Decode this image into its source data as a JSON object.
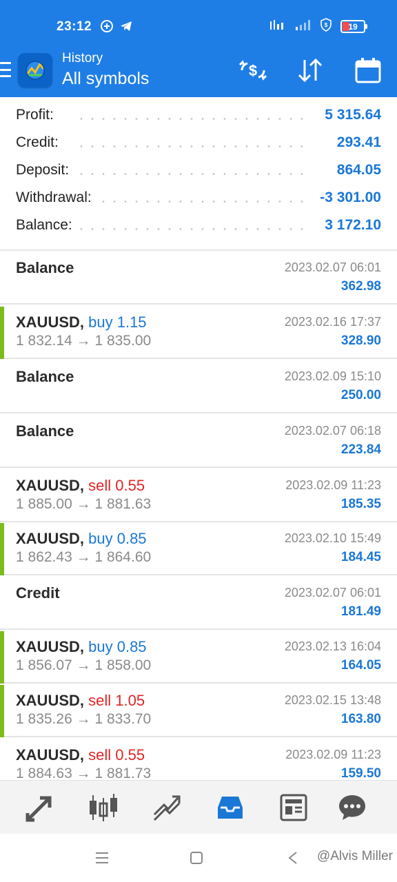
{
  "status_bar": {
    "time": "23:12",
    "battery": "19",
    "icons": [
      "plus-circle-icon",
      "telegram-icon",
      "network-speed-icon",
      "signal-icon",
      "vpn-shield-icon",
      "battery-icon"
    ]
  },
  "app_bar": {
    "subtitle": "History",
    "title": "All symbols",
    "icons": [
      "menu-icon",
      "app-logo-icon",
      "currency-exchange-icon",
      "sort-icon",
      "calendar-icon"
    ]
  },
  "summary": {
    "rows": [
      {
        "label": "Profit:",
        "value": "5 315.64"
      },
      {
        "label": "Credit:",
        "value": "293.41"
      },
      {
        "label": "Deposit:",
        "value": "864.05"
      },
      {
        "label": "Withdrawal:",
        "value": "-3 301.00"
      },
      {
        "label": "Balance:",
        "value": "3 172.10"
      }
    ]
  },
  "history": {
    "items": [
      {
        "kind": "op",
        "title": "Balance",
        "date": "2023.02.07 06:01",
        "amount": "362.98"
      },
      {
        "kind": "deal",
        "symbol": "XAUUSD,",
        "side": "buy",
        "volume": "buy 1.15",
        "open": "1 832.14",
        "close": "1 835.00",
        "arrow": "→",
        "date": "2023.02.16 17:37",
        "amount": "328.90"
      },
      {
        "kind": "op",
        "title": "Balance",
        "date": "2023.02.09 15:10",
        "amount": "250.00"
      },
      {
        "kind": "op",
        "title": "Balance",
        "date": "2023.02.07 06:18",
        "amount": "223.84"
      },
      {
        "kind": "deal",
        "symbol": "XAUUSD,",
        "side": "sell",
        "volume": "sell 0.55",
        "open": "1 885.00",
        "close": "1 881.63",
        "arrow": "→",
        "date": "2023.02.09 11:23",
        "amount": "185.35"
      },
      {
        "kind": "deal",
        "symbol": "XAUUSD,",
        "side": "buy",
        "volume": "buy 0.85",
        "open": "1 862.43",
        "close": "1 864.60",
        "arrow": "→",
        "date": "2023.02.10 15:49",
        "amount": "184.45"
      },
      {
        "kind": "op",
        "title": "Credit",
        "date": "2023.02.07 06:01",
        "amount": "181.49"
      },
      {
        "kind": "deal",
        "symbol": "XAUUSD,",
        "side": "buy",
        "volume": "buy 0.85",
        "open": "1 856.07",
        "close": "1 858.00",
        "arrow": "→",
        "date": "2023.02.13 16:04",
        "amount": "164.05"
      },
      {
        "kind": "deal",
        "symbol": "XAUUSD,",
        "side": "sell",
        "volume": "sell 1.05",
        "open": "1 835.26",
        "close": "1 833.70",
        "arrow": "→",
        "date": "2023.02.15 13:48",
        "amount": "163.80"
      },
      {
        "kind": "deal",
        "symbol": "XAUUSD,",
        "side": "sell",
        "volume": "sell 0.55",
        "open": "1 884.63",
        "close": "1 881.73",
        "arrow": "→",
        "date": "2023.02.09 11:23",
        "amount": "159.50"
      }
    ]
  },
  "tab_bar": {
    "tabs": [
      {
        "icon": "quotes-icon",
        "active": false
      },
      {
        "icon": "chart-candles-icon",
        "active": false
      },
      {
        "icon": "trade-icon",
        "active": false
      },
      {
        "icon": "history-inbox-icon",
        "active": true
      },
      {
        "icon": "news-icon",
        "active": false
      },
      {
        "icon": "chat-icon",
        "active": false
      }
    ]
  },
  "system_nav": {
    "icons": [
      "menu-lines-icon",
      "home-square-icon",
      "back-icon"
    ],
    "watermark": "@Alvis Miller"
  },
  "colors": {
    "app_bar": "#1f7ee6",
    "accent_blue": "#1a77d6",
    "sell_red": "#e02424",
    "deal_bar_green": "#7cbb1a"
  }
}
